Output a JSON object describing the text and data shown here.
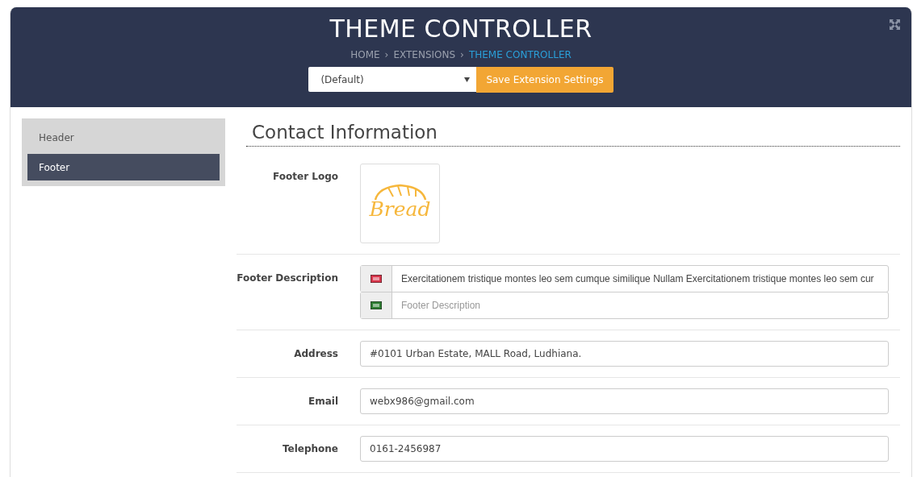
{
  "header": {
    "title": "THEME CONTROLLER",
    "breadcrumb_separator": "›",
    "breadcrumb": [
      {
        "label": "HOME",
        "current": false
      },
      {
        "label": "EXTENSIONS",
        "current": false
      },
      {
        "label": "THEME CONTROLLER",
        "current": true
      }
    ],
    "store_select": {
      "value": "(Default)"
    },
    "save_button": "Save Extension Settings"
  },
  "sidebar": {
    "items": [
      {
        "label": "Header",
        "selected": false
      },
      {
        "label": "Footer",
        "selected": true
      }
    ]
  },
  "section": {
    "title": "Contact Information",
    "fields": [
      {
        "kind": "image",
        "label": "Footer Logo",
        "logo_text": "Bread"
      },
      {
        "kind": "multilang",
        "label": "Footer Description",
        "languages": [
          {
            "color": "#d8344a",
            "value": "Exercitationem tristique montes leo sem cumque similique Nullam Exercitationem tristique montes leo sem cur"
          },
          {
            "color": "#2e7d32",
            "placeholder": "Footer Description"
          }
        ]
      },
      {
        "kind": "text",
        "label": "Address",
        "value": "#0101 Urban Estate, MALL Road, Ludhiana."
      },
      {
        "kind": "text",
        "label": "Email",
        "value": "webx986@gmail.com"
      },
      {
        "kind": "text",
        "label": "Telephone",
        "value": "0161-2456987"
      }
    ]
  }
}
